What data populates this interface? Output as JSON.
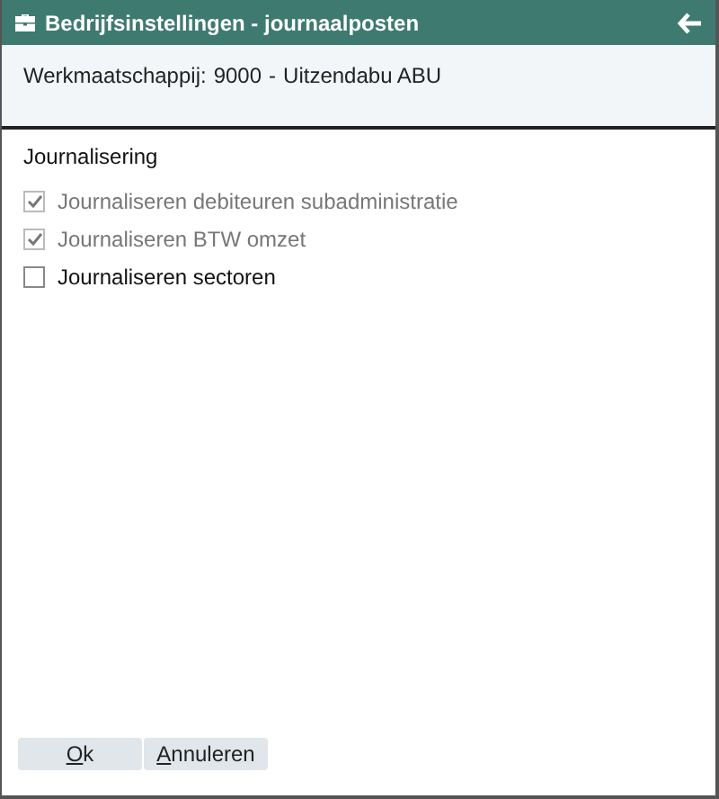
{
  "window": {
    "title": "Bedrijfsinstellingen - journaalposten"
  },
  "header": {
    "label": "Werkmaatschappij:",
    "code": "9000",
    "separator": "-",
    "name": "Uitzendabu ABU"
  },
  "section": {
    "title": "Journalisering",
    "options": [
      {
        "label": "Journaliseren debiteuren subadministratie",
        "checked": true,
        "disabled": true
      },
      {
        "label": "Journaliseren BTW omzet",
        "checked": true,
        "disabled": true
      },
      {
        "label": "Journaliseren sectoren",
        "checked": false,
        "disabled": false
      }
    ]
  },
  "buttons": [
    {
      "label": "Ok"
    },
    {
      "label": "Annuleren"
    }
  ]
}
